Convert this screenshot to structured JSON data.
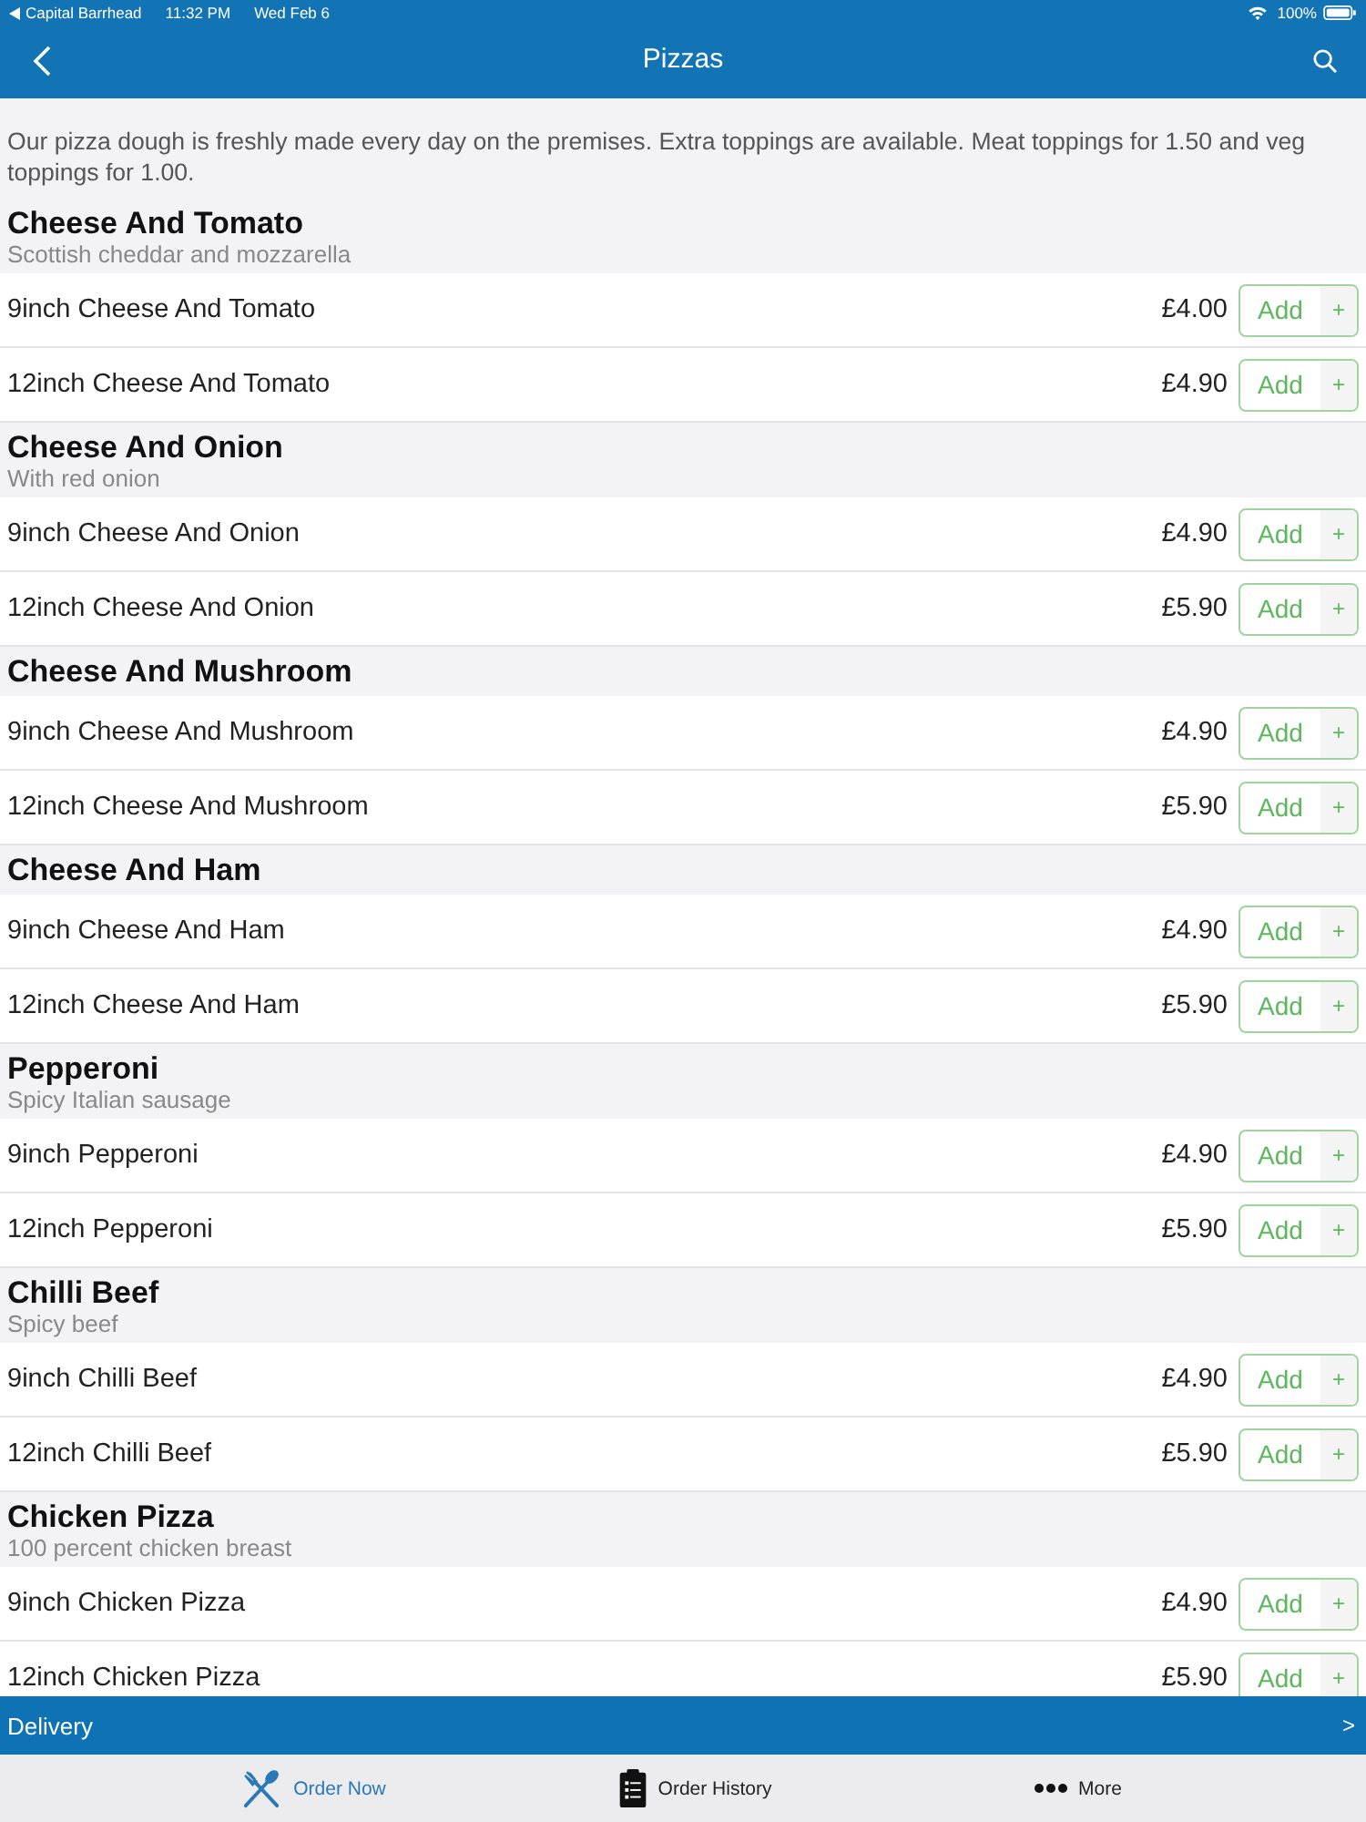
{
  "status_bar": {
    "back_app": "Capital Barrhead",
    "time": "11:32 PM",
    "date": "Wed Feb 6",
    "battery": "100%"
  },
  "nav_bar": {
    "title": "Pizzas"
  },
  "intro": "Our pizza dough is freshly made every day on the premises. Extra toppings are available. Meat toppings for 1.50 and veg toppings for 1.00.",
  "sections": [
    {
      "title": "Cheese And Tomato",
      "subtitle": "Scottish cheddar and mozzarella",
      "items": [
        {
          "name": "9inch Cheese And Tomato",
          "price": "£4.00",
          "add": "Add",
          "plus": "+"
        },
        {
          "name": "12inch Cheese And Tomato",
          "price": "£4.90",
          "add": "Add",
          "plus": "+"
        }
      ]
    },
    {
      "title": "Cheese And Onion",
      "subtitle": "With red onion",
      "items": [
        {
          "name": "9inch Cheese And Onion",
          "price": "£4.90",
          "add": "Add",
          "plus": "+"
        },
        {
          "name": "12inch Cheese And Onion",
          "price": "£5.90",
          "add": "Add",
          "plus": "+"
        }
      ]
    },
    {
      "title": "Cheese And Mushroom",
      "items": [
        {
          "name": "9inch Cheese And Mushroom",
          "price": "£4.90",
          "add": "Add",
          "plus": "+"
        },
        {
          "name": "12inch Cheese And Mushroom",
          "price": "£5.90",
          "add": "Add",
          "plus": "+"
        }
      ]
    },
    {
      "title": "Cheese And Ham",
      "items": [
        {
          "name": "9inch Cheese And Ham",
          "price": "£4.90",
          "add": "Add",
          "plus": "+"
        },
        {
          "name": "12inch Cheese And Ham",
          "price": "£5.90",
          "add": "Add",
          "plus": "+"
        }
      ]
    },
    {
      "title": "Pepperoni",
      "subtitle": "Spicy Italian sausage",
      "items": [
        {
          "name": "9inch Pepperoni",
          "price": "£4.90",
          "add": "Add",
          "plus": "+"
        },
        {
          "name": "12inch Pepperoni",
          "price": "£5.90",
          "add": "Add",
          "plus": "+"
        }
      ]
    },
    {
      "title": "Chilli Beef",
      "subtitle": "Spicy beef",
      "items": [
        {
          "name": "9inch Chilli Beef",
          "price": "£4.90",
          "add": "Add",
          "plus": "+"
        },
        {
          "name": "12inch Chilli Beef",
          "price": "£5.90",
          "add": "Add",
          "plus": "+"
        }
      ]
    },
    {
      "title": "Chicken Pizza",
      "subtitle": "100 percent chicken breast",
      "items": [
        {
          "name": "9inch Chicken Pizza",
          "price": "£4.90",
          "add": "Add",
          "plus": "+"
        },
        {
          "name": "12inch Chicken Pizza",
          "price": "£5.90",
          "add": "Add",
          "plus": "+"
        }
      ]
    }
  ],
  "delivery_bar": {
    "label": "Delivery",
    "arrow": ">"
  },
  "tabs": [
    {
      "label": "Order Now",
      "selected": true,
      "kind": "utensils"
    },
    {
      "label": "Order History",
      "selected": false,
      "kind": "clipboard"
    },
    {
      "label": "More",
      "selected": false,
      "kind": "dots"
    }
  ]
}
